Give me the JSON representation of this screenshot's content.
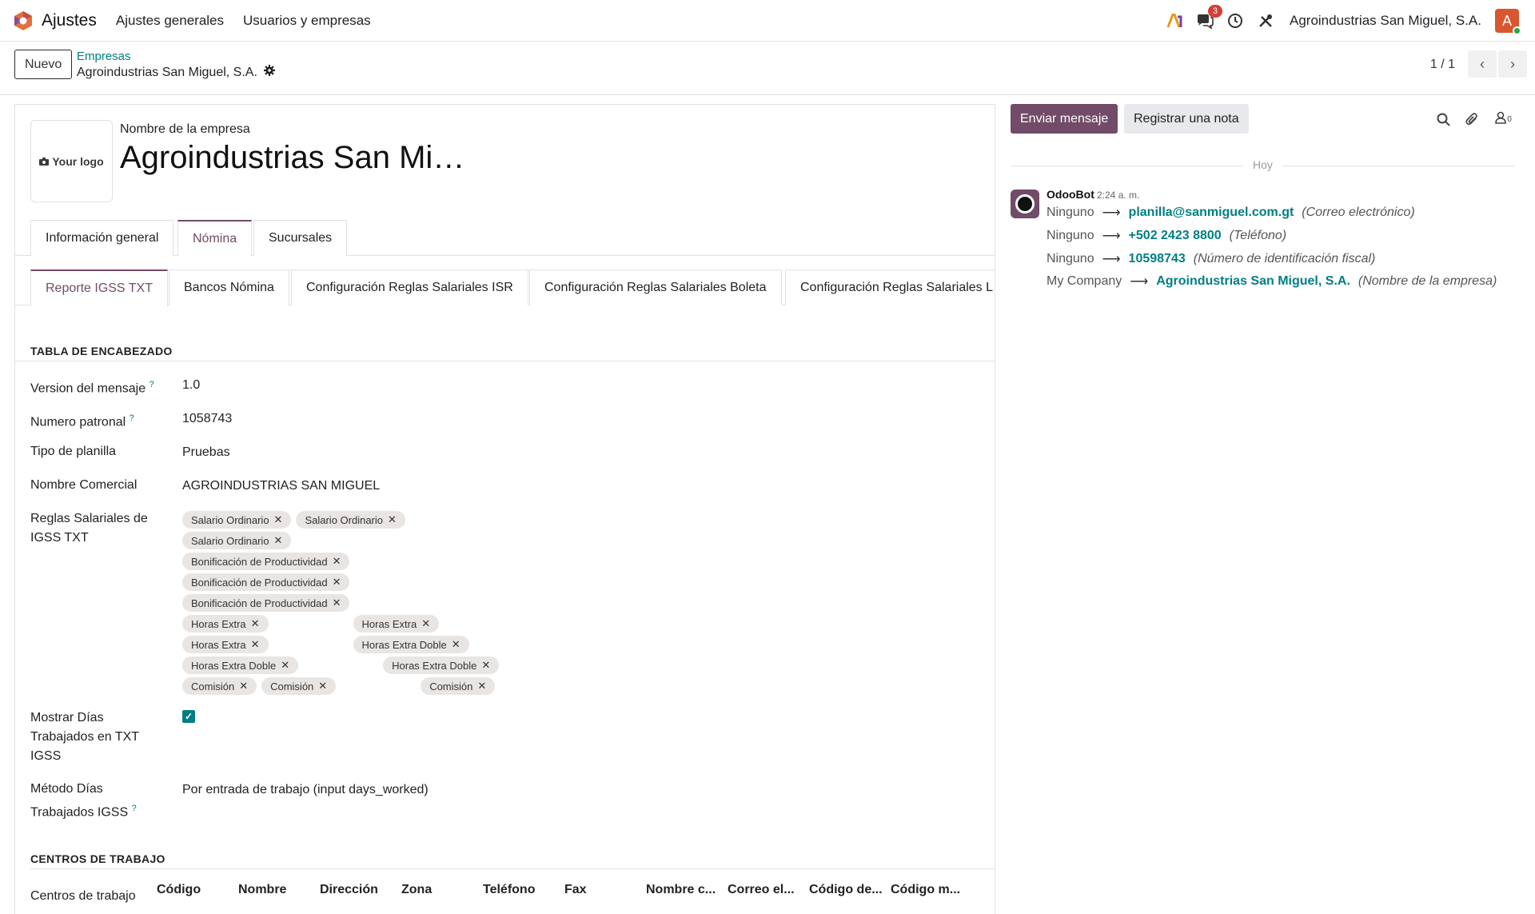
{
  "navbar": {
    "app_title": "Ajustes",
    "menu": [
      "Ajustes generales",
      "Usuarios y empresas"
    ],
    "messages_badge": "3",
    "company": "Agroindustrias San Miguel, S.A.",
    "avatar_letter": "A"
  },
  "control": {
    "new_label": "Nuevo",
    "breadcrumb_parent": "Empresas",
    "breadcrumb_current": "Agroindustrias San Miguel, S.A.",
    "pager": "1 / 1"
  },
  "form": {
    "logo_text": "Your logo",
    "company_label": "Nombre de la empresa",
    "company_title": "Agroindustrias San Mi…",
    "tabs": [
      "Información general",
      "Nómina",
      "Sucursales"
    ],
    "subtabs": [
      "Reporte IGSS TXT",
      "Bancos Nómina",
      "Configuración Reglas Salariales ISR",
      "Configuración Reglas Salariales Boleta",
      "Configuración Reglas Salariales L"
    ],
    "section_header": "TABLA DE ENCABEZADO",
    "fields": {
      "version_label": "Version del mensaje",
      "version_value": "1.0",
      "patronal_label": "Numero patronal",
      "patronal_value": "1058743",
      "planilla_label": "Tipo de planilla",
      "planilla_value": "Pruebas",
      "comercial_label": "Nombre Comercial",
      "comercial_value": "AGROINDUSTRIAS SAN MIGUEL",
      "reglas_label": "Reglas Salariales de IGSS TXT",
      "mostrar_label": "Mostrar Días Trabajados en TXT IGSS",
      "metodo_label": "Método Días Trabajados IGSS",
      "metodo_value": "Por entrada de trabajo (input days_worked)"
    },
    "tags": [
      "Salario Ordinario",
      "Salario Ordinario",
      "Salario Ordinario",
      "Bonificación de Productividad",
      "Bonificación de Productividad",
      "Bonificación de Productividad",
      "Horas Extra",
      "Horas Extra",
      "Horas Extra",
      "Horas Extra Doble",
      "Horas Extra Doble",
      "Horas Extra Doble",
      "Comisión",
      "Comisión",
      "Comisión"
    ],
    "section_centros": "CENTROS DE TRABAJO",
    "centros_label": "Centros de trabajo",
    "table_columns": [
      "Código",
      "Nombre",
      "Dirección",
      "Zona",
      "Teléfono",
      "Fax",
      "Nombre c...",
      "Correo el...",
      "Código de...",
      "Código m..."
    ]
  },
  "chatter": {
    "send_label": "Enviar mensaje",
    "note_label": "Registrar una nota",
    "followers_count": "0",
    "today": "Hoy",
    "author": "OdooBot",
    "time": "2:24 a. m.",
    "tracking": [
      {
        "old": "Ninguno",
        "new": "planilla@sanmiguel.com.gt",
        "field": "(Correo electrónico)"
      },
      {
        "old": "Ninguno",
        "new": "+502 2423 8800",
        "field": "(Teléfono)"
      },
      {
        "old": "Ninguno",
        "new": "10598743",
        "field": "(Número de identificación fiscal)"
      },
      {
        "old": "My Company",
        "new": "Agroindustrias San Miguel, S.A.",
        "field": "(Nombre de la empresa)"
      }
    ]
  },
  "colors": {
    "primary": "#714b67",
    "link": "#017e84"
  }
}
